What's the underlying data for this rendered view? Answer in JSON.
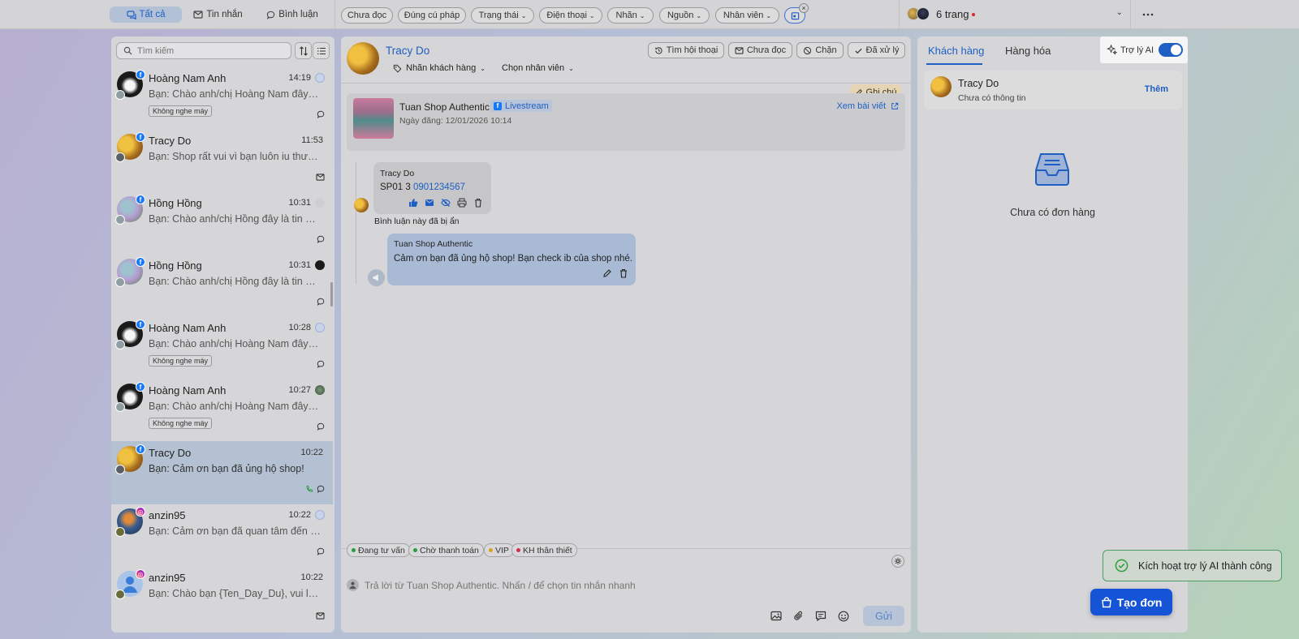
{
  "topbar": {
    "tabs": [
      {
        "label": "Tất cả"
      },
      {
        "label": "Tin nhắn"
      },
      {
        "label": "Bình luận"
      }
    ],
    "filters": [
      {
        "label": "Chưa đọc"
      },
      {
        "label": "Đúng cú pháp"
      },
      {
        "label": "Trạng thái"
      },
      {
        "label": "Điện thoại"
      },
      {
        "label": "Nhãn"
      },
      {
        "label": "Nguồn"
      },
      {
        "label": "Nhân viên"
      }
    ],
    "pages_label": "6 trang"
  },
  "search": {
    "placeholder": "Tìm kiếm"
  },
  "conversations": [
    {
      "name": "Hoàng Nam Anh",
      "time": "14:19",
      "message": "Bạn: Chào anh/chị Hoàng Nam đây là...",
      "tag": "Không nghe máy"
    },
    {
      "name": "Tracy Do",
      "time": "11:53",
      "message": "Bạn: Shop rất vui vì bạn luôn iu thương..."
    },
    {
      "name": "Hồng Hồng",
      "time": "10:31",
      "message": "Bạn: Chào anh/chị Hồng đây là tin nh..."
    },
    {
      "name": "Hồng Hồng",
      "time": "10:31",
      "message": "Bạn: Chào anh/chị Hồng đây là tin nh..."
    },
    {
      "name": "Hoàng Nam Anh",
      "time": "10:28",
      "message": "Bạn: Chào anh/chị Hoàng Nam đây là...",
      "tag": "Không nghe máy"
    },
    {
      "name": "Hoàng Nam Anh",
      "time": "10:27",
      "message": "Bạn: Chào anh/chị Hoàng Nam đây là...",
      "tag": "Không nghe máy"
    },
    {
      "name": "Tracy Do",
      "time": "10:22",
      "message": "Bạn: Cảm ơn bạn đã ủng hộ shop!"
    },
    {
      "name": "anzin95",
      "time": "10:22",
      "message": "Bạn: Cảm ơn bạn đã quan tâm đến sh..."
    },
    {
      "name": "anzin95",
      "time": "10:22",
      "message": "Bạn: Chào bạn {Ten_Day_Du}, vui lòn..."
    }
  ],
  "chat": {
    "contact_name": "Tracy Do",
    "tag_button": "Nhãn khách hàng",
    "staff_button": "Chọn nhân viên",
    "actions": {
      "history": "Tìm hội thoại",
      "unread": "Chưa đọc",
      "block": "Chặn",
      "done": "Đã xử lý"
    },
    "note": "Ghi chú",
    "post": {
      "shop": "Tuan Shop Authentic",
      "type": "Livestream",
      "date": "Ngày đăng: 12/01/2026 10:14",
      "view": "Xem bài viết"
    },
    "comment": {
      "author": "Tracy Do",
      "text_prefix": "SP01 3",
      "phone": "0901234567",
      "hidden_note": "Bình luận này đã bị ẩn"
    },
    "reply": {
      "author": "Tuan Shop Authentic",
      "text": "Cảm ơn bạn đã ủng hộ shop! Bạn check ib của shop nhé."
    },
    "statuses": [
      {
        "label": "Đang tư vấn",
        "color": "#2a9d3a"
      },
      {
        "label": "Chờ thanh toán",
        "color": "#2a9d3a"
      },
      {
        "label": "VIP",
        "color": "#d8a11a"
      },
      {
        "label": "KH thân thiết",
        "color": "#d62d4a"
      }
    ],
    "input_placeholder": "Trả lời từ Tuan Shop Authentic. Nhấn / để chọn tin nhắn nhanh",
    "send": "Gửi"
  },
  "right": {
    "tabs": [
      {
        "label": "Khách hàng"
      },
      {
        "label": "Hàng hóa"
      }
    ],
    "ai_label": "Trợ lý AI",
    "ai_enabled": true,
    "customer": {
      "name": "Tracy Do",
      "info": "Chưa có thông tin",
      "add": "Thêm"
    },
    "empty": "Chưa có đơn hàng",
    "create": "Tạo đơn"
  },
  "toast": "Kích hoạt trợ lý AI thành công",
  "colors": {
    "accent": "#1f5fc4",
    "facebook": "#1877f2",
    "instagram": "#d6249f",
    "success": "#2a9d3a"
  }
}
